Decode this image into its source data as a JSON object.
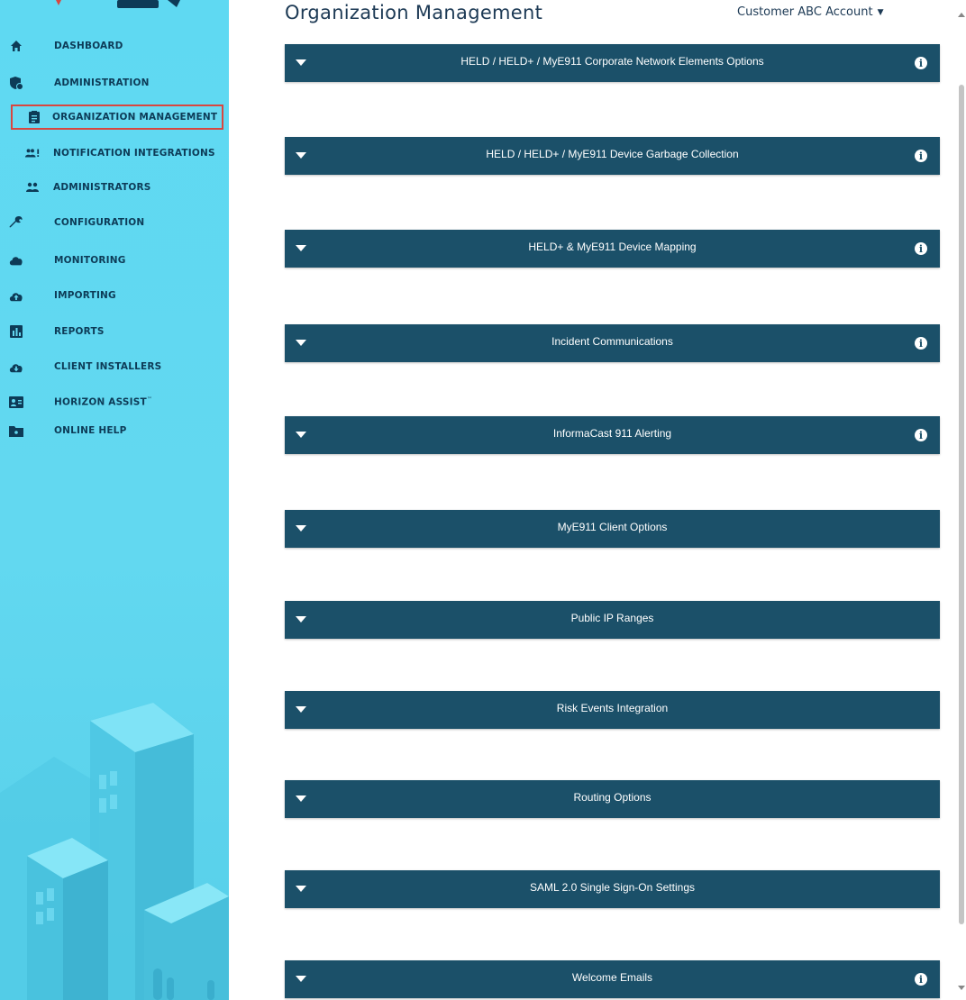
{
  "sidebar": {
    "items": [
      {
        "label": "DASHBOARD",
        "icon": "home-icon",
        "level": "top"
      },
      {
        "label": "ADMINISTRATION",
        "icon": "admin-shield-icon",
        "level": "top"
      },
      {
        "label": "ORGANIZATION MANAGEMENT",
        "icon": "clipboard-icon",
        "level": "sub",
        "active": true
      },
      {
        "label": "NOTIFICATION INTEGRATIONS",
        "icon": "people-notification-icon",
        "level": "sub"
      },
      {
        "label": "ADMINISTRATORS",
        "icon": "people-icon",
        "level": "sub"
      },
      {
        "label": "CONFIGURATION",
        "icon": "wrench-icon",
        "level": "top"
      },
      {
        "label": "MONITORING",
        "icon": "cloud-icon",
        "level": "top"
      },
      {
        "label": "IMPORTING",
        "icon": "cloud-upload-icon",
        "level": "top"
      },
      {
        "label": "REPORTS",
        "icon": "bar-chart-icon",
        "level": "top"
      },
      {
        "label": "CLIENT INSTALLERS",
        "icon": "cloud-download-icon",
        "level": "top"
      },
      {
        "label": "HORIZON ASSIST",
        "icon": "contact-card-icon",
        "level": "top",
        "superscript": "™"
      },
      {
        "label": "ONLINE HELP",
        "icon": "help-folder-icon",
        "level": "top"
      }
    ]
  },
  "header": {
    "title": "Organization Management",
    "account_label": "Customer ABC Account"
  },
  "panels": [
    {
      "title": "HELD / HELD+ / MyE911 Corporate Network Elements Options",
      "info": true
    },
    {
      "title": "HELD / HELD+ / MyE911 Device Garbage Collection",
      "info": true
    },
    {
      "title": "HELD+ & MyE911 Device Mapping",
      "info": true
    },
    {
      "title": "Incident Communications",
      "info": true
    },
    {
      "title": "InformaCast 911 Alerting",
      "info": true
    },
    {
      "title": "MyE911 Client Options",
      "info": false
    },
    {
      "title": "Public IP Ranges",
      "info": false
    },
    {
      "title": "Risk Events Integration",
      "info": false
    },
    {
      "title": "Routing Options",
      "info": false
    },
    {
      "title": "SAML 2.0 Single Sign-On Settings",
      "info": false
    },
    {
      "title": "Welcome Emails",
      "info": true
    }
  ],
  "colors": {
    "sidebar_bg": "#62d8f0",
    "panel_header_bg": "#1b5069",
    "active_outline": "#d9463f",
    "nav_text": "#0d3b57"
  }
}
